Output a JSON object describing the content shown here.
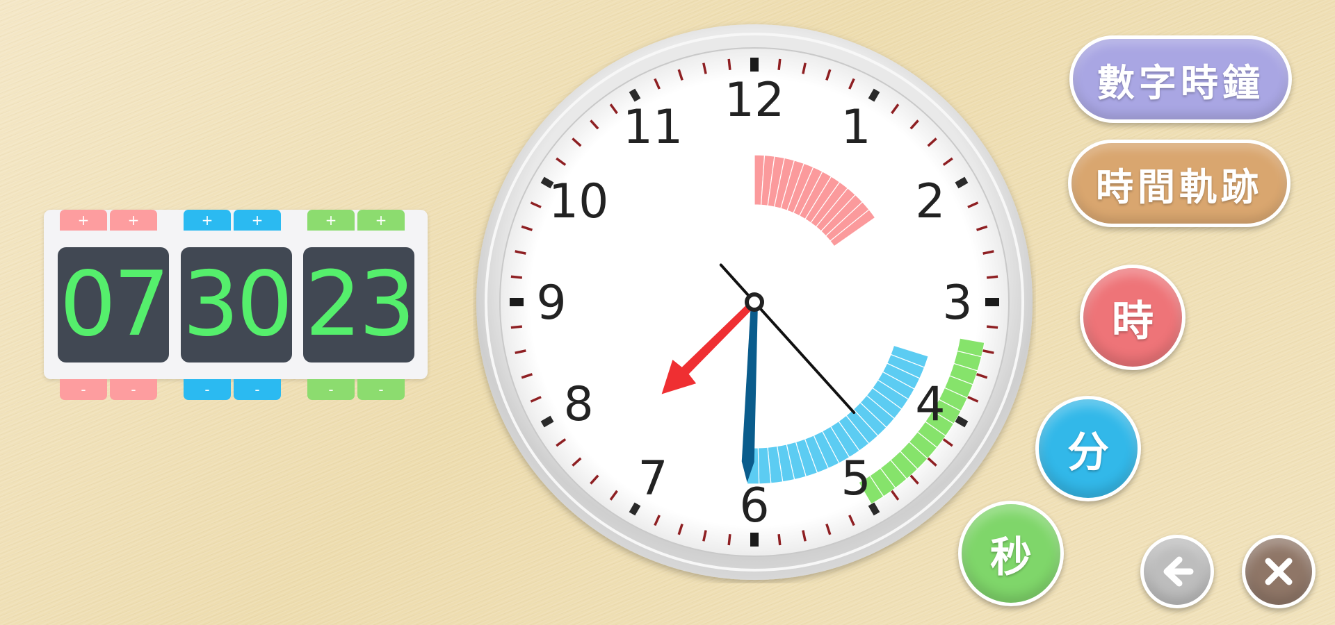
{
  "digital": {
    "hours": "07",
    "minutes": "30",
    "seconds": "23",
    "plus_label": "+",
    "minus_label": "-"
  },
  "analog": {
    "numbers": [
      "12",
      "1",
      "2",
      "3",
      "4",
      "5",
      "6",
      "7",
      "8",
      "9",
      "10",
      "11"
    ],
    "time": {
      "hour": 7,
      "minute": 30,
      "second": 23
    },
    "hour_hand_color": "#ef2f32",
    "minute_hand_color": "#0a5c8c",
    "second_hand_color": "#111111",
    "hour_trail_color": "#fb9a9c",
    "minute_trail_color": "#5cccf2",
    "second_trail_color": "#86e36b"
  },
  "buttons": {
    "digital_clock": "數字時鐘",
    "time_trail": "時間軌跡",
    "hour": "時",
    "minute": "分",
    "second": "秒",
    "back_icon": "arrow-left-icon",
    "close_icon": "close-icon"
  },
  "colors": {
    "digital_clock_button": "#a9a6e3",
    "time_trail_button": "#d9a66f",
    "hour_button": "#ee7478",
    "minute_button": "#32b8e9",
    "second_button": "#7fd66a",
    "back_button": "#bdbdbd",
    "close_button": "#8f7667"
  }
}
